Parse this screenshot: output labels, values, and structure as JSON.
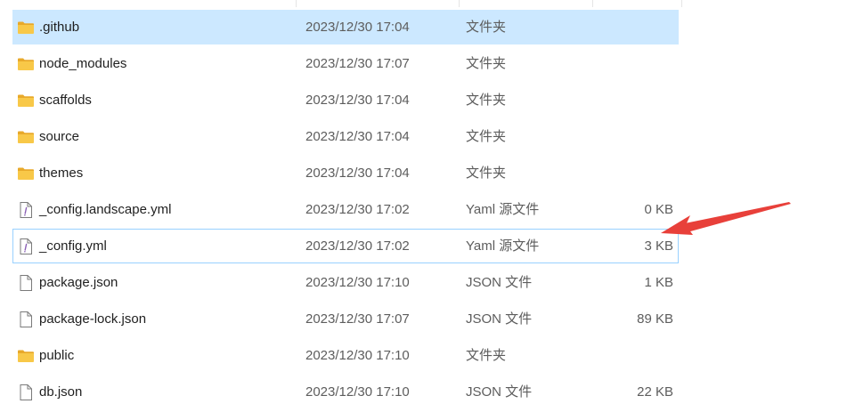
{
  "files": [
    {
      "name": ".github",
      "modified": "2023/12/30 17:04",
      "type": "文件夹",
      "size": "",
      "icon": "folder-icon",
      "selected": true,
      "focused": false
    },
    {
      "name": "node_modules",
      "modified": "2023/12/30 17:07",
      "type": "文件夹",
      "size": "",
      "icon": "folder-icon",
      "selected": false,
      "focused": false
    },
    {
      "name": "scaffolds",
      "modified": "2023/12/30 17:04",
      "type": "文件夹",
      "size": "",
      "icon": "folder-icon",
      "selected": false,
      "focused": false
    },
    {
      "name": "source",
      "modified": "2023/12/30 17:04",
      "type": "文件夹",
      "size": "",
      "icon": "folder-icon",
      "selected": false,
      "focused": false
    },
    {
      "name": "themes",
      "modified": "2023/12/30 17:04",
      "type": "文件夹",
      "size": "",
      "icon": "folder-icon",
      "selected": false,
      "focused": false
    },
    {
      "name": "_config.landscape.yml",
      "modified": "2023/12/30 17:02",
      "type": "Yaml 源文件",
      "size": "0 KB",
      "icon": "yaml-file-icon",
      "selected": false,
      "focused": false
    },
    {
      "name": "_config.yml",
      "modified": "2023/12/30 17:02",
      "type": "Yaml 源文件",
      "size": "3 KB",
      "icon": "yaml-file-icon",
      "selected": false,
      "focused": true
    },
    {
      "name": "package.json",
      "modified": "2023/12/30 17:10",
      "type": "JSON 文件",
      "size": "1 KB",
      "icon": "file-icon",
      "selected": false,
      "focused": false
    },
    {
      "name": "package-lock.json",
      "modified": "2023/12/30 17:07",
      "type": "JSON 文件",
      "size": "89 KB",
      "icon": "file-icon",
      "selected": false,
      "focused": false
    },
    {
      "name": "public",
      "modified": "2023/12/30 17:10",
      "type": "文件夹",
      "size": "",
      "icon": "folder-icon",
      "selected": false,
      "focused": false
    },
    {
      "name": "db.json",
      "modified": "2023/12/30 17:10",
      "type": "JSON 文件",
      "size": "22 KB",
      "icon": "file-icon",
      "selected": false,
      "focused": false
    }
  ],
  "colors": {
    "selection": "#cce8ff",
    "focus_border": "#99d1ff",
    "folder": "#f8c848",
    "folder_dark": "#e8a92a",
    "annotation_arrow": "#e8403a"
  },
  "annotation": {
    "icon": "red-arrow-icon",
    "points_to": "_config.yml"
  }
}
